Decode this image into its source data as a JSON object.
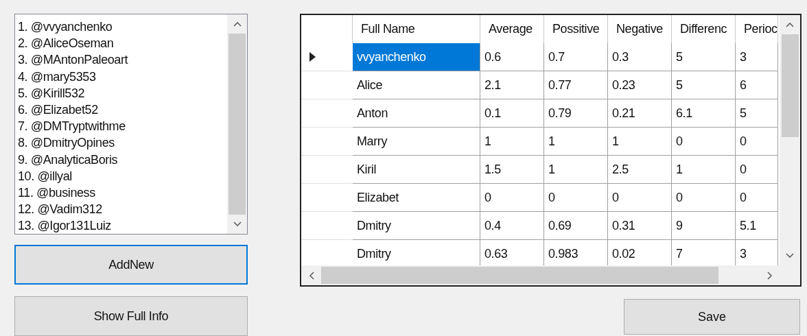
{
  "accounts_list": {
    "items": [
      {
        "label": "1. @vvyanchenko"
      },
      {
        "label": "2. @AliceOseman"
      },
      {
        "label": "3. @MAntonPaleoart"
      },
      {
        "label": "4. @mary5353"
      },
      {
        "label": "5. @Kirill532"
      },
      {
        "label": "6. @Elizabet52"
      },
      {
        "label": "7. @DMTryptwithme"
      },
      {
        "label": "8. @DmitryOpines"
      },
      {
        "label": "9. @AnalyticaBoris"
      },
      {
        "label": "10. @illyal"
      },
      {
        "label": "11. @business"
      },
      {
        "label": "12. @Vadim312"
      },
      {
        "label": "13. @Igor131Luiz"
      }
    ]
  },
  "buttons": [
    {
      "label": "AddNew",
      "focused": true
    },
    {
      "label": "Show Full Info",
      "focused": false
    }
  ],
  "table": {
    "columns": [
      "Full Name",
      "Average",
      "Possitive",
      "Negative",
      "Differenc",
      "Perioc"
    ],
    "rows": [
      {
        "selected": true,
        "cells": [
          "vvyanchenko",
          "0.6",
          "0.7",
          "0.3",
          "5",
          "3"
        ]
      },
      {
        "selected": false,
        "cells": [
          "Alice",
          "2.1",
          "0.77",
          "0.23",
          "5",
          "6"
        ]
      },
      {
        "selected": false,
        "cells": [
          "Anton",
          "0.1",
          "0.79",
          "0.21",
          "6.1",
          "5"
        ]
      },
      {
        "selected": false,
        "cells": [
          "Marry",
          "1",
          "1",
          "1",
          "0",
          "0"
        ]
      },
      {
        "selected": false,
        "cells": [
          "Kiril",
          "1.5",
          "1",
          "2.5",
          "1",
          "0"
        ]
      },
      {
        "selected": false,
        "cells": [
          "Elizabet",
          "0",
          "0",
          "0",
          "0",
          "0"
        ]
      },
      {
        "selected": false,
        "cells": [
          "Dmitry",
          "0.4",
          "0.69",
          "0.31",
          "9",
          "5.1"
        ]
      },
      {
        "selected": false,
        "cells": [
          "Dmitry",
          "0.63",
          "0.983",
          "0.02",
          "7",
          "3"
        ]
      }
    ]
  },
  "save_button": {
    "label": "Save"
  }
}
